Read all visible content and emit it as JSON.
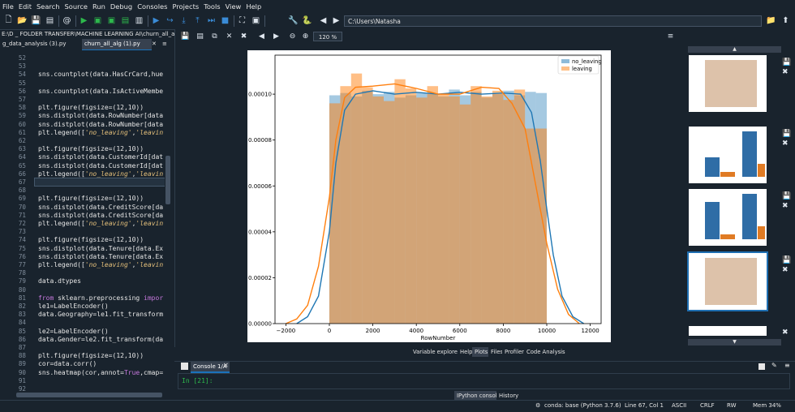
{
  "menu": [
    "File",
    "Edit",
    "Search",
    "Source",
    "Run",
    "Debug",
    "Consoles",
    "Projects",
    "Tools",
    "View",
    "Help"
  ],
  "toolbar": {
    "path": "C:\\Users\\Natasha"
  },
  "editor": {
    "header": "E:\\D _ FOLDER TRANSFER\\MACHINE LEARNING AI\\churn_all_alg (1).py",
    "tabs": [
      "g_data_analysis (3).py",
      "churn_all_alg (1).py"
    ],
    "lines": [
      {
        "n": "52",
        "t": ""
      },
      {
        "n": "53",
        "t": ""
      },
      {
        "n": "54",
        "t": "sns.countplot(data.HasCrCard,hue"
      },
      {
        "n": "55",
        "t": ""
      },
      {
        "n": "56",
        "t": "sns.countplot(data.IsActiveMembe"
      },
      {
        "n": "57",
        "t": ""
      },
      {
        "n": "58",
        "t": "plt.figure(figsize=(12,10))"
      },
      {
        "n": "59",
        "t": "sns.distplot(data.RowNumber[data"
      },
      {
        "n": "60",
        "t": "sns.distplot(data.RowNumber[data"
      },
      {
        "n": "61",
        "t": "plt.legend(['no_leaving','leavin"
      },
      {
        "n": "62",
        "t": ""
      },
      {
        "n": "63",
        "t": "plt.figure(figsize=(12,10))"
      },
      {
        "n": "64",
        "t": "sns.distplot(data.CustomerId[dat"
      },
      {
        "n": "65",
        "t": "sns.distplot(data.CustomerId[dat"
      },
      {
        "n": "66",
        "t": "plt.legend(['no_leaving','leavin"
      },
      {
        "n": "67",
        "t": ""
      },
      {
        "n": "68",
        "t": ""
      },
      {
        "n": "69",
        "t": "plt.figure(figsize=(12,10))"
      },
      {
        "n": "70",
        "t": "sns.distplot(data.CreditScore[da"
      },
      {
        "n": "71",
        "t": "sns.distplot(data.CreditScore[da"
      },
      {
        "n": "72",
        "t": "plt.legend(['no_leaving','leavin"
      },
      {
        "n": "73",
        "t": ""
      },
      {
        "n": "74",
        "t": "plt.figure(figsize=(12,10))"
      },
      {
        "n": "75",
        "t": "sns.distplot(data.Tenure[data.Ex"
      },
      {
        "n": "76",
        "t": "sns.distplot(data.Tenure[data.Ex"
      },
      {
        "n": "77",
        "t": "plt.legend(['no_leaving','leavin"
      },
      {
        "n": "78",
        "t": ""
      },
      {
        "n": "79",
        "t": "data.dtypes"
      },
      {
        "n": "80",
        "t": ""
      },
      {
        "n": "81",
        "t": "from sklearn.preprocessing impor"
      },
      {
        "n": "82",
        "t": "le1=LabelEncoder()"
      },
      {
        "n": "83",
        "t": "data.Geography=le1.fit_transform"
      },
      {
        "n": "84",
        "t": ""
      },
      {
        "n": "85",
        "t": "le2=LabelEncoder()"
      },
      {
        "n": "86",
        "t": "data.Gender=le2.fit_transform(da"
      },
      {
        "n": "87",
        "t": ""
      },
      {
        "n": "88",
        "t": "plt.figure(figsize=(12,10))"
      },
      {
        "n": "89",
        "t": "cor=data.corr()"
      },
      {
        "n": "90",
        "t": "sns.heatmap(cor,annot=True,cmap="
      },
      {
        "n": "91",
        "t": ""
      },
      {
        "n": "92",
        "t": ""
      }
    ]
  },
  "plots": {
    "zoom": "120 %",
    "panel_tabs": [
      "Variable explorer",
      "Help",
      "Plots",
      "Files",
      "Profiler",
      "Code Analysis"
    ],
    "active_tab": "Plots"
  },
  "chart_data": {
    "type": "bar",
    "xlabel": "RowNumber",
    "xticks": [
      "−2000",
      "0",
      "2000",
      "4000",
      "6000",
      "8000",
      "10000",
      "12000"
    ],
    "yticks": [
      "0.00000",
      "0.00002",
      "0.00004",
      "0.00006",
      "0.00008",
      "0.00010"
    ],
    "xlim": [
      -2500,
      12500
    ],
    "ylim": [
      0,
      0.000117
    ],
    "legend": [
      "no_leaving",
      "leaving"
    ],
    "legend_position": "top-right",
    "colors": {
      "no_leaving": "#1f77b4",
      "leaving": "#ff7f0e"
    },
    "bin_edges": [
      0,
      500,
      1000,
      1500,
      2000,
      2500,
      3000,
      3500,
      4000,
      4500,
      5000,
      5500,
      6000,
      6500,
      7000,
      7500,
      8000,
      8500,
      9000,
      9500,
      10000
    ],
    "series": [
      {
        "name": "no_leaving",
        "values": [
          9.95e-05,
          0.0001005,
          9.9e-05,
          0.0001015,
          0.0001,
          0.000101,
          9.85e-05,
          9.95e-05,
          0.0001005,
          0.0001,
          9.9e-05,
          0.000102,
          9.95e-05,
          0.000101,
          9.85e-05,
          0.0001,
          0.0001015,
          9.95e-05,
          0.000101,
          0.0001005
        ]
      },
      {
        "name": "leaving",
        "values": [
          9.6e-05,
          0.0001035,
          0.000109,
          0.000103,
          9.9e-05,
          9.7e-05,
          0.0001065,
          0.0001025,
          9.85e-05,
          0.0001035,
          0.0001,
          9.9e-05,
          9.55e-05,
          0.0001035,
          9.9e-05,
          0.0001015,
          9.75e-05,
          0.000102,
          8.5e-05,
          8.5e-05
        ]
      }
    ],
    "kde": [
      {
        "name": "no_leaving",
        "x": [
          -1500,
          -1000,
          -500,
          0,
          300,
          700,
          1200,
          2000,
          3000,
          4000,
          5000,
          6000,
          7000,
          8000,
          8800,
          9300,
          9700,
          10000,
          10300,
          10700,
          11200,
          11700
        ],
        "y": [
          0,
          3e-06,
          1.2e-05,
          4e-05,
          7e-05,
          9.3e-05,
          0.0001,
          0.0001015,
          0.0001,
          0.0001008,
          0.0001,
          0.0001008,
          0.0001,
          0.0001005,
          0.0001,
          9.2e-05,
          7.1e-05,
          5e-05,
          3e-05,
          1.2e-05,
          3e-06,
          0
        ]
      },
      {
        "name": "leaving",
        "x": [
          -2000,
          -1500,
          -1000,
          -500,
          0,
          300,
          700,
          1200,
          2000,
          3000,
          4000,
          5000,
          6000,
          7000,
          7800,
          8400,
          9000,
          9500,
          10000,
          10500,
          11000,
          11500
        ],
        "y": [
          0,
          2e-06,
          8e-06,
          2.5e-05,
          5.5e-05,
          8e-05,
          9.85e-05,
          0.000103,
          0.0001035,
          0.0001045,
          0.0001025,
          0.0001,
          0.0001,
          0.000103,
          0.0001025,
          9.6e-05,
          8.5e-05,
          6e-05,
          3.5e-05,
          1.5e-05,
          4e-06,
          0
        ]
      }
    ]
  },
  "console": {
    "tab": "Console 1/A",
    "prompt": "In [21]:",
    "bottom_tabs": [
      "IPython console",
      "History"
    ]
  },
  "status": {
    "env": "conda: base (Python 3.7.6)",
    "cursor": "Line 67, Col 1",
    "encoding": "ASCII",
    "eol": "CRLF",
    "rw": "RW",
    "mem": "Mem 34%"
  }
}
